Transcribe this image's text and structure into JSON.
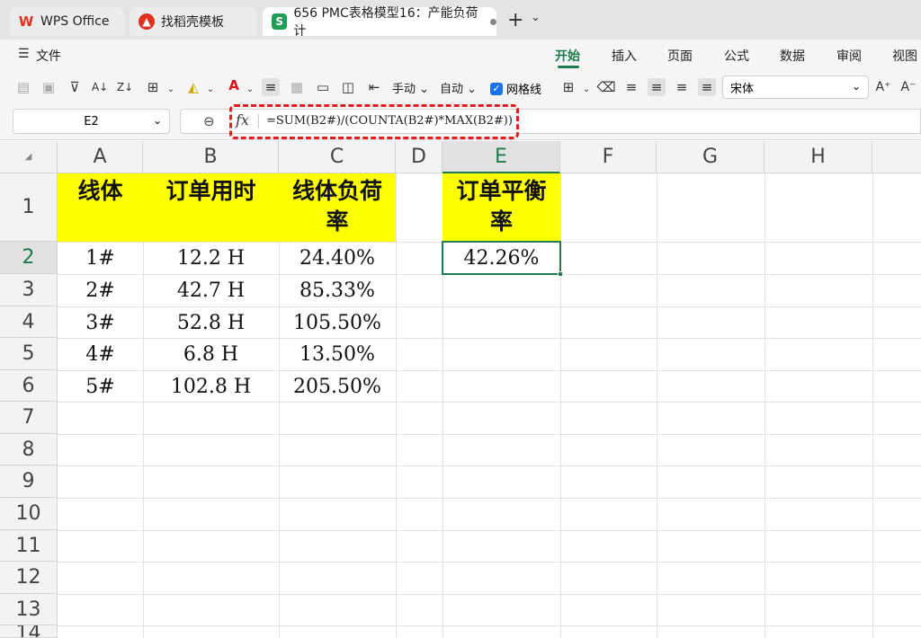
{
  "tabs": {
    "wps": "WPS Office",
    "template": "找稻壳模板",
    "doc": "656 PMC表格模型16：产能负荷计",
    "new_tab": "+",
    "new_tab_menu": "⌄"
  },
  "menu": {
    "file": "文件",
    "items": [
      "开始",
      "插入",
      "页面",
      "公式",
      "数据",
      "审阅",
      "视图"
    ]
  },
  "toolbar": {
    "manual": "手动",
    "auto": "自动",
    "gridlines": "网格线",
    "gridlines_checked": true,
    "font": "宋体",
    "increase_font": "A⁺",
    "decrease_font": "A⁻"
  },
  "formula_bar": {
    "cell_ref": "E2",
    "fx": "fx",
    "formula": "=SUM(B2#)/(COUNTA(B2#)*MAX(B2#))"
  },
  "sheet": {
    "columns": [
      "A",
      "B",
      "C",
      "D",
      "E",
      "F",
      "G",
      "H"
    ],
    "rows": [
      "1",
      "2",
      "3",
      "4",
      "5",
      "6",
      "7",
      "8",
      "9",
      "10",
      "11",
      "12",
      "13",
      "14"
    ],
    "selected_cell": "E2",
    "header_row": {
      "A1": "线体",
      "B1": "订单用时",
      "C1_line1": "线体负荷",
      "C1_line2": "率",
      "E1_line1": "订单平衡",
      "E1_line2": "率"
    },
    "data": [
      {
        "line": "1#",
        "time": "12.2 H",
        "load": "24.40%"
      },
      {
        "line": "2#",
        "time": "42.7 H",
        "load": "85.33%"
      },
      {
        "line": "3#",
        "time": "52.8 H",
        "load": "105.50%"
      },
      {
        "line": "4#",
        "time": "6.8 H",
        "load": "13.50%"
      },
      {
        "line": "5#",
        "time": "102.8 H",
        "load": "205.50%"
      }
    ],
    "E2": "42.26%"
  },
  "colors": {
    "accent": "#1f7a4d",
    "header_fill": "#ffff00",
    "annotation": "#e01e1e"
  }
}
